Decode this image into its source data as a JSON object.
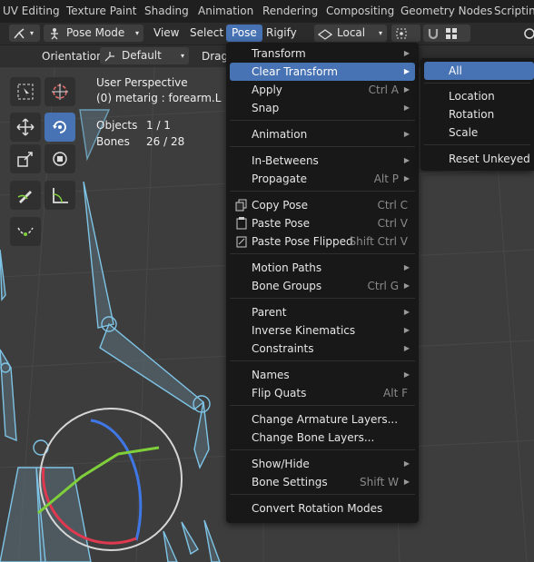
{
  "workspaces": [
    "UV Editing",
    "Texture Paint",
    "Shading",
    "Animation",
    "Rendering",
    "Compositing",
    "Geometry Nodes",
    "Scripting"
  ],
  "header": {
    "mode": "Pose Mode",
    "menus": [
      "View",
      "Select",
      "Pose",
      "Rigify"
    ],
    "active_menu": "Pose",
    "orientation": "Local"
  },
  "tool_settings": {
    "orientation_label": "Orientation:",
    "orientation_value": "Default",
    "drag_label": "Drag:"
  },
  "viewport": {
    "perspective": "User Perspective",
    "object_name": "(0) metarig : forearm.L",
    "stats": [
      {
        "label": "Objects",
        "value": "1 / 1"
      },
      {
        "label": "Bones",
        "value": "26 / 28"
      }
    ]
  },
  "pose_menu": [
    {
      "label": "Transform",
      "shortcut": "",
      "submenu": true
    },
    {
      "label": "Clear Transform",
      "shortcut": "",
      "submenu": true,
      "highlight": true
    },
    {
      "label": "Apply",
      "shortcut": "Ctrl A",
      "submenu": true
    },
    {
      "label": "Snap",
      "shortcut": "",
      "submenu": true
    },
    {
      "label": "Animation",
      "shortcut": "",
      "submenu": true
    },
    {
      "label": "In-Betweens",
      "shortcut": "",
      "submenu": true
    },
    {
      "label": "Propagate",
      "shortcut": "Alt P",
      "submenu": true
    },
    {
      "label": "Copy Pose",
      "shortcut": "Ctrl C",
      "submenu": false,
      "icon": "copy-icon"
    },
    {
      "label": "Paste Pose",
      "shortcut": "Ctrl V",
      "submenu": false,
      "icon": "paste-icon"
    },
    {
      "label": "Paste Pose Flipped",
      "shortcut": "Shift Ctrl V",
      "submenu": false,
      "icon": "paste-flipped-icon"
    },
    {
      "label": "Motion Paths",
      "shortcut": "",
      "submenu": true
    },
    {
      "label": "Bone Groups",
      "shortcut": "Ctrl G",
      "submenu": true
    },
    {
      "label": "Parent",
      "shortcut": "",
      "submenu": true
    },
    {
      "label": "Inverse Kinematics",
      "shortcut": "",
      "submenu": true
    },
    {
      "label": "Constraints",
      "shortcut": "",
      "submenu": true
    },
    {
      "label": "Names",
      "shortcut": "",
      "submenu": true
    },
    {
      "label": "Flip Quats",
      "shortcut": "Alt F",
      "submenu": false
    },
    {
      "label": "Change Armature Layers...",
      "shortcut": "",
      "submenu": false
    },
    {
      "label": "Change Bone Layers...",
      "shortcut": "",
      "submenu": false
    },
    {
      "label": "Show/Hide",
      "shortcut": "",
      "submenu": true
    },
    {
      "label": "Bone Settings",
      "shortcut": "Shift W",
      "submenu": true
    },
    {
      "label": "Convert Rotation Modes",
      "shortcut": "",
      "submenu": false
    }
  ],
  "clear_menu": [
    {
      "label": "All",
      "highlight": true
    },
    {
      "label": "Location"
    },
    {
      "label": "Rotation"
    },
    {
      "label": "Scale"
    },
    {
      "label": "Reset Unkeyed"
    }
  ],
  "colors": {
    "accent": "#4772b3",
    "bone": "#7ec4e6",
    "menu_bg": "#181818"
  }
}
